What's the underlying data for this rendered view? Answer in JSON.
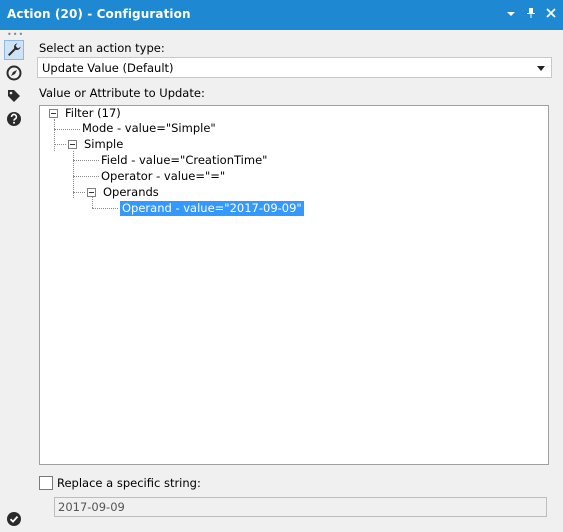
{
  "window": {
    "title": "Action (20) - Configuration",
    "colors": {
      "titlebar": "#1e88d2",
      "selection": "#3399ff"
    }
  },
  "rail": {
    "icons": [
      "wrench-icon",
      "compass-icon",
      "tag-icon",
      "help-icon"
    ],
    "bottom_icon": "checkmark-icon"
  },
  "form": {
    "action_type_label": "Select an action type:",
    "action_type_value": "Update Value (Default)",
    "tree_label": "Value or Attribute to Update:",
    "tree": {
      "root": "Filter (17)",
      "mode": "Mode - value=\"Simple\"",
      "simple": "Simple",
      "field": "Field - value=\"CreationTime\"",
      "operator": "Operator - value=\"=\"",
      "operands": "Operands",
      "operand": "Operand - value=\"2017-09-09\""
    },
    "replace_label": "Replace a specific string:",
    "replace_checked": false,
    "replace_value": "2017-09-09"
  }
}
